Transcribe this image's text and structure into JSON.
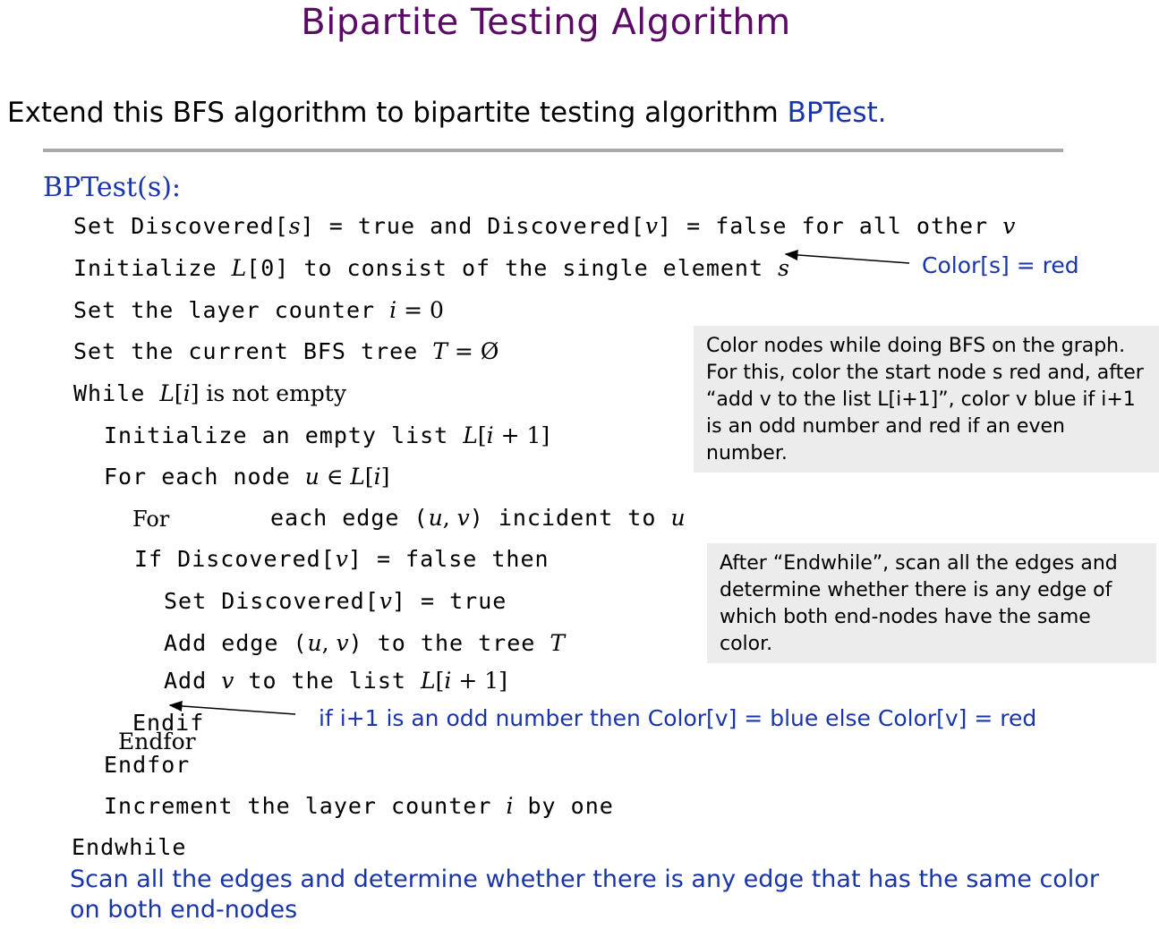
{
  "title": "Bipartite Testing Algorithm",
  "subtitle": {
    "text": "Extend this BFS algorithm to bipartite testing algorithm ",
    "highlight": "BPTest."
  },
  "procedure": {
    "name": "BPTest(s):",
    "lines": {
      "l1": {
        "a": "Set Discovered[",
        "s": "s",
        "b": "] = true and Discovered[",
        "v": "v",
        "c": "] = false for all other ",
        "v2": "v"
      },
      "l2": {
        "a": "Initialize ",
        "L": "L",
        "b": "[0] to consist of the single element ",
        "s": "s"
      },
      "l3": {
        "a": "Set the layer counter ",
        "i": "i",
        "b": " = 0"
      },
      "l4": {
        "a": "Set the current BFS tree ",
        "T": "T",
        "b": " = Ø"
      },
      "l5": {
        "a": "While ",
        "L": "L",
        "b": "[",
        "i": "i",
        "c": "] is not empty"
      },
      "l6": {
        "a": "Initialize an empty list ",
        "L": "L",
        "b": "[",
        "i": "i",
        "c": " + 1]"
      },
      "l7": {
        "a": "For each node ",
        "u": "u",
        "b": " ∈ ",
        "L": "L",
        "c": "[",
        "i": "i",
        "d": "]"
      },
      "l8": {
        "for": "For",
        "a": "each edge (",
        "u": "u",
        "b": ", ",
        "v": "v",
        "c": ") incident to ",
        "u2": "u"
      },
      "l9": {
        "a": "If Discovered[",
        "v": "v",
        "b": "] = false then"
      },
      "l10": {
        "a": "Set Discovered[",
        "v": "v",
        "b": "] = true"
      },
      "l11": {
        "a": "Add edge (",
        "u": "u",
        "b": ", ",
        "v": "v",
        "c": ") to the tree ",
        "T": "T"
      },
      "l12": {
        "a": "Add ",
        "v": "v",
        "b": " to the list ",
        "L": "L",
        "c": "[",
        "i": "i",
        "d": " + 1]"
      },
      "l13": "Endif",
      "l13b": "Endfor",
      "l14": "Endfor",
      "l15": {
        "a": "Increment the layer counter ",
        "i": "i",
        "b": " by one"
      },
      "l16": "Endwhile"
    }
  },
  "annotations": {
    "color_s": "Color[s] = red",
    "odd_even": "if i+1 is an odd number then Color[v] = blue else Color[v] = red",
    "box1": "Color nodes while doing BFS on the graph. For this, color the start node s red and, after “add v to the list L[i+1]”, color v blue if i+1 is an odd number and red if an even number.",
    "box2": "After “Endwhile”, scan all the edges and determine whether there is any edge of which both end-nodes have the same color.",
    "bottom": "Scan all the edges and determine whether there is any edge that has the same color on both end-nodes"
  },
  "colors": {
    "title": "#5b0a66",
    "blue_text": "#1a35a8",
    "box_bg": "#ececec",
    "rule": "#a9a9a9"
  }
}
